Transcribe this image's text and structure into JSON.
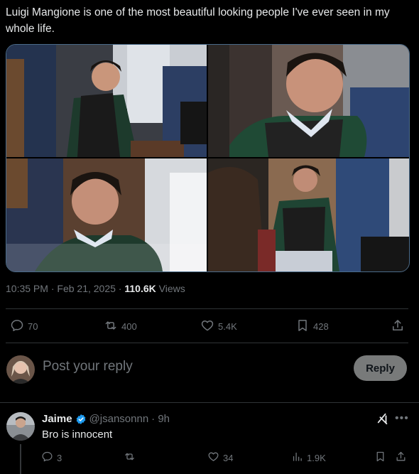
{
  "post": {
    "text": "Luigi Mangione is one of the most beautiful looking people I've ever seen in my whole life.",
    "time": "10:35 PM",
    "separator": "·",
    "date": "Feb 21, 2025",
    "views_count": "110.6K",
    "views_label": "Views"
  },
  "actions": {
    "replies": "70",
    "reposts": "400",
    "likes": "5.4K",
    "bookmarks": "428"
  },
  "composer": {
    "placeholder": "Post your reply",
    "button_label": "Reply"
  },
  "reply": {
    "name": "Jaime",
    "handle": "@jsansonnn",
    "time": "· 9h",
    "text": "Bro is innocent",
    "replies": "3",
    "likes": "34",
    "views": "1.9K"
  },
  "colors": {
    "background": "#000000",
    "text": "#e7e9ea",
    "muted": "#71767b",
    "verified": "#1d9bf0",
    "divider": "#2f3336",
    "reply_button": "#787a7a"
  },
  "icons": [
    "reply-icon",
    "repost-icon",
    "like-icon",
    "bookmark-icon",
    "share-icon",
    "views-icon",
    "verified-badge-icon",
    "grok-icon",
    "more-icon"
  ]
}
